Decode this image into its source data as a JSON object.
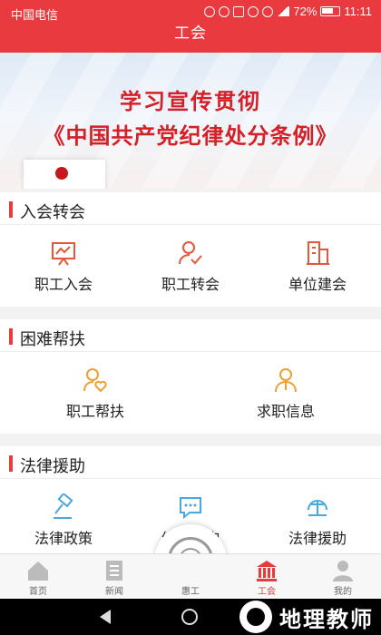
{
  "status_bar": {
    "carrier": "中国电信",
    "battery": "72%",
    "time": "11:11"
  },
  "header": {
    "title": "工会"
  },
  "banner": {
    "line1": "学习宣传贯彻",
    "line2": "《中国共产党纪律处分条例》"
  },
  "sections": [
    {
      "title": "入会转会",
      "items": [
        {
          "label": "职工入会",
          "icon": "chart-board-icon"
        },
        {
          "label": "职工转会",
          "icon": "user-check-icon"
        },
        {
          "label": "单位建会",
          "icon": "building-icon"
        }
      ]
    },
    {
      "title": "困难帮扶",
      "items": [
        {
          "label": "职工帮扶",
          "icon": "user-heart-icon"
        },
        {
          "label": "求职信息",
          "icon": "user-badge-icon"
        }
      ]
    },
    {
      "title": "法律援助",
      "items": [
        {
          "label": "法律政策",
          "icon": "gavel-icon"
        },
        {
          "label": "维权咨询",
          "icon": "chat-bubble-icon"
        },
        {
          "label": "法律援助",
          "icon": "legal-aid-icon"
        }
      ]
    }
  ],
  "tabbar": {
    "tabs": [
      {
        "label": "首页",
        "icon": "home-icon"
      },
      {
        "label": "新闻",
        "icon": "news-icon"
      },
      {
        "label": "惠工",
        "icon": "union-emblem-icon"
      },
      {
        "label": "工会",
        "icon": "union-building-icon"
      },
      {
        "label": "我的",
        "icon": "profile-icon"
      }
    ],
    "active_index": 3
  },
  "watermark": {
    "text": "地理教师"
  },
  "colors": {
    "accent": "#e83a3f",
    "icon_red": "#e8563a",
    "icon_orange": "#f0a030",
    "icon_blue": "#4aa8e0"
  }
}
